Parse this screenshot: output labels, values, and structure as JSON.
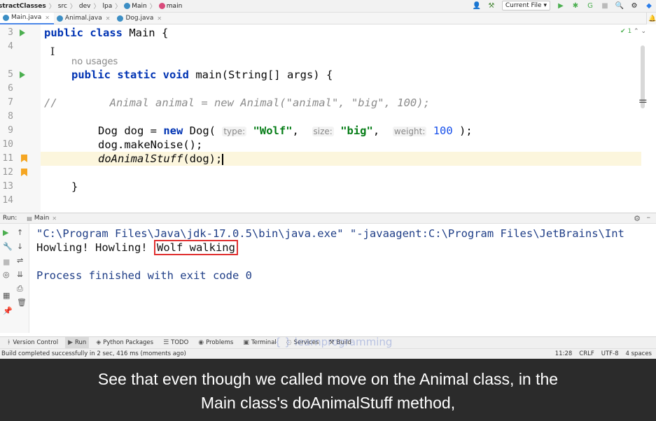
{
  "navbar": {
    "crumbs": [
      "stractClasses",
      "src",
      "dev",
      "lpa",
      "Main",
      "main"
    ],
    "run_config": "Current File"
  },
  "tabs": [
    {
      "label": "Main.java",
      "active": true
    },
    {
      "label": "Animal.java",
      "active": false
    },
    {
      "label": "Dog.java",
      "active": false
    }
  ],
  "editor": {
    "line_numbers": [
      "3",
      "4",
      "5",
      "6",
      "7",
      "8",
      "9",
      "10",
      "11",
      "12",
      "13",
      "14"
    ],
    "usage_hint": "no usages",
    "inspection_badge": "✔ 1",
    "code": {
      "l3_kw": "public class",
      "l3_rest": " Main {",
      "l5_kw": "public static void",
      "l5_rest": " main(String[] args) {",
      "l7_comment_marker": "//",
      "l7_comment": "Animal animal = new Animal(\"animal\", \"big\", 100);",
      "l9_start": "Dog dog = ",
      "l9_new": "new",
      "l9_cls": " Dog( ",
      "hint_type": "type:",
      "val_type": "\"Wolf\"",
      "hint_size": "size:",
      "val_size": "\"big\"",
      "hint_weight": "weight:",
      "val_weight": "100",
      "l9_end": " );",
      "l10": "dog.makeNoise();",
      "l11_method": "doAnimalStuff",
      "l11_rest": "(dog);",
      "l13": "}"
    }
  },
  "run_panel": {
    "label": "Run:",
    "config": "Main",
    "lines": [
      "\"C:\\Program Files\\Java\\jdk-17.0.5\\bin\\java.exe\" \"-javaagent:C:\\Program Files\\JetBrains\\Int",
      "Process finished with exit code 0"
    ],
    "output_prefix": "Howling! Howling! ",
    "output_highlight": "Wolf walking"
  },
  "tool_windows": [
    "Version Control",
    "Run",
    "Python Packages",
    "TODO",
    "Problems",
    "Terminal",
    "Services",
    "Build"
  ],
  "status": {
    "message": "Build completed successfully in 2 sec, 416 ms (moments ago)",
    "position": "11:28",
    "line_ending": "CRLF",
    "encoding": "UTF-8",
    "indent": "4 spaces"
  },
  "watermark": "{ } learnprogramming",
  "caption": {
    "line1": "See that even though we called move on the Animal class, in the",
    "line2": "Main class's doAnimalStuff method,"
  },
  "colors": {
    "keyword": "#0033b3",
    "string": "#067d17",
    "number": "#1750eb",
    "highlight_box": "#e03030",
    "caption_bg": "#2b2b2b"
  }
}
